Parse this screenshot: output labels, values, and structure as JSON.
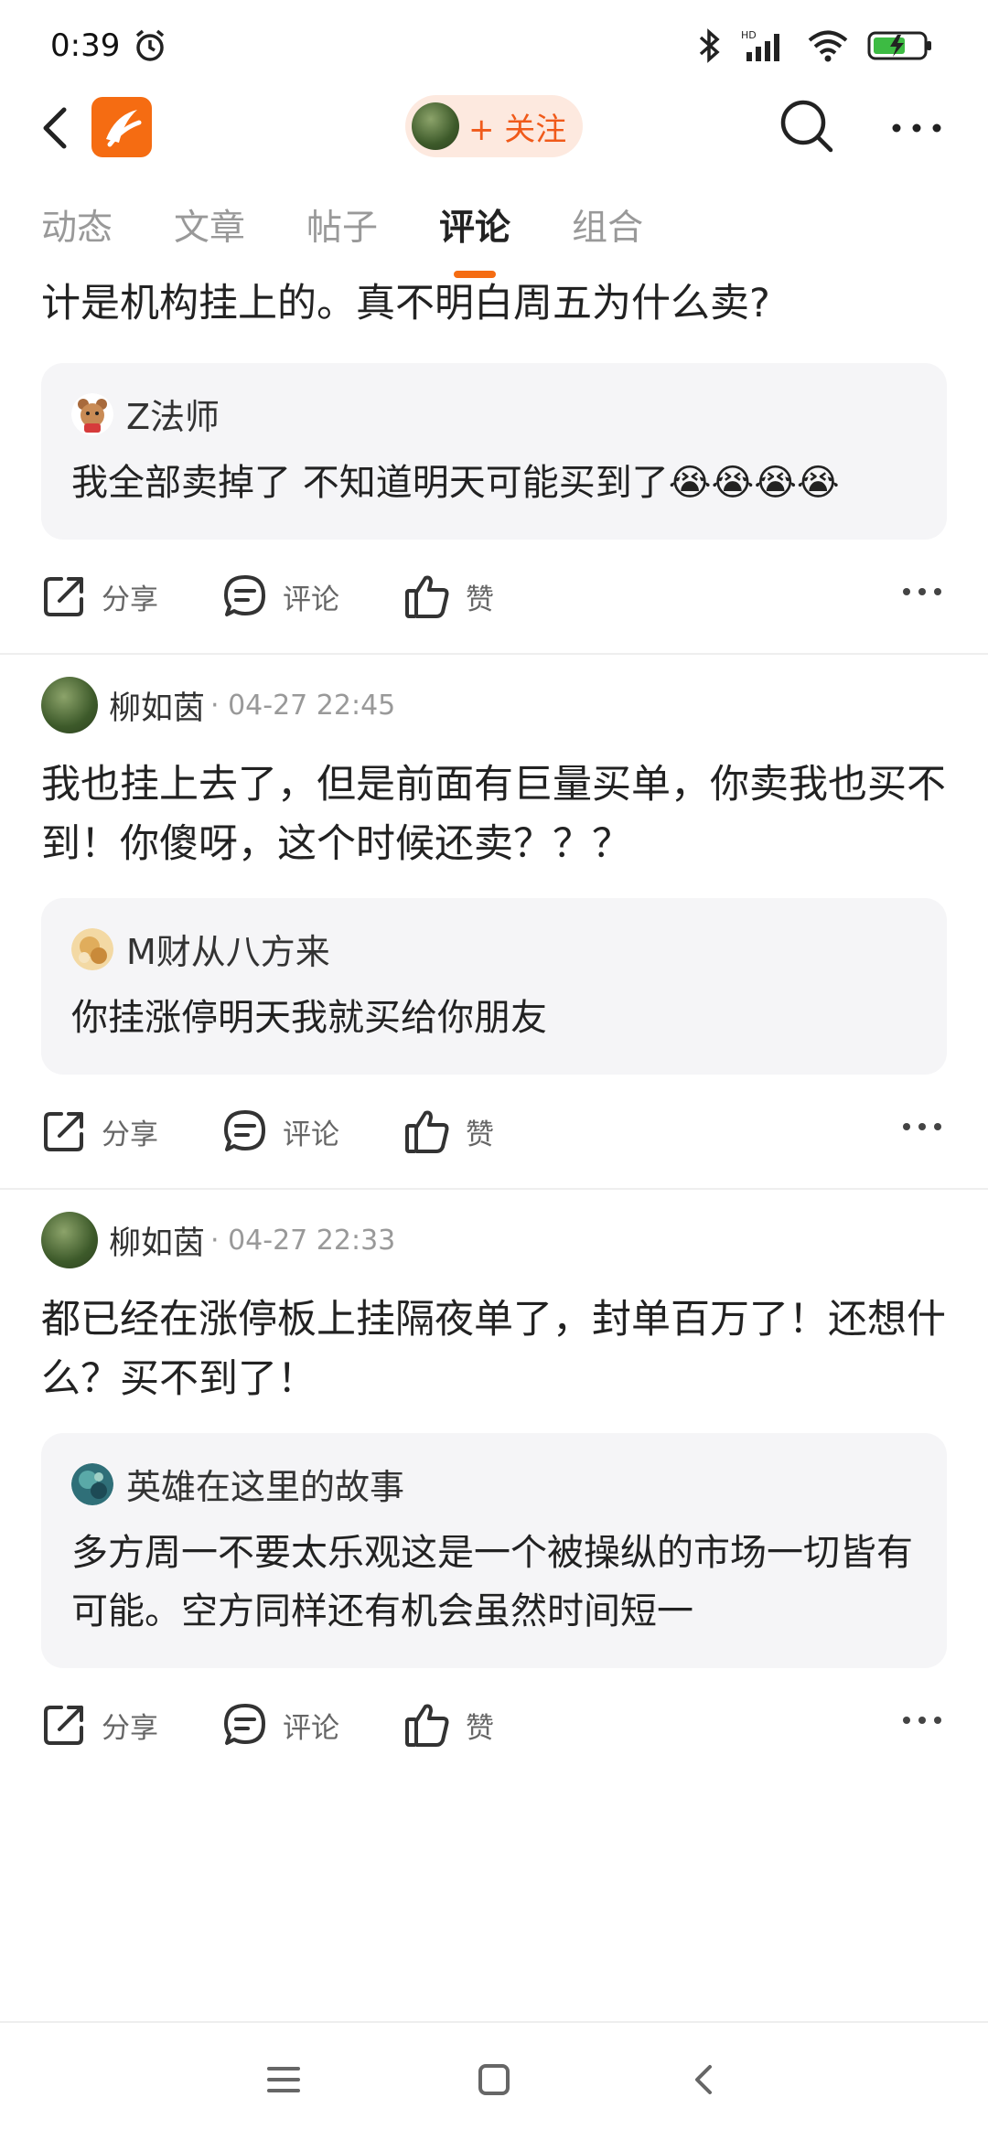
{
  "status_bar": {
    "time": "0:39"
  },
  "nav": {
    "follow_label": "+ 关注"
  },
  "tabs": [
    {
      "label": "动态"
    },
    {
      "label": "文章"
    },
    {
      "label": "帖子"
    },
    {
      "label": "评论"
    },
    {
      "label": "组合"
    }
  ],
  "active_tab": "评论",
  "posts": [
    {
      "text": "买不到了，我还想再买点。但前面已有巨量封单，估计是机构挂上的。真不明白周五为什么卖?",
      "quote": {
        "name": "Z法师",
        "text": "我全部卖掉了 不知道明天可能买到了",
        "emoji": "😭😭😭😭"
      }
    },
    {
      "author": "柳如茵",
      "time": "· 04-27 22:45",
      "text": "我也挂上去了，但是前面有巨量买单，你卖我也买不到！你傻呀，这个时候还卖？？？",
      "quote": {
        "name": "M财从八方来",
        "text": "你挂涨停明天我就买给你朋友"
      }
    },
    {
      "author": "柳如茵",
      "time": "· 04-27 22:33",
      "text": "都已经在涨停板上挂隔夜单了，封单百万了！还想什么？买不到了！",
      "quote": {
        "name": "英雄在这里的故事",
        "text": "多方周一不要太乐观这是一个被操纵的市场一切皆有可能。空方同样还有机会虽然时间短一"
      }
    }
  ],
  "actions": {
    "share": "分享",
    "comment": "评论",
    "like": "赞"
  },
  "colors": {
    "accent": "#f56c12",
    "follow_bg": "#fde9df",
    "quote_bg": "#f5f5f7"
  }
}
